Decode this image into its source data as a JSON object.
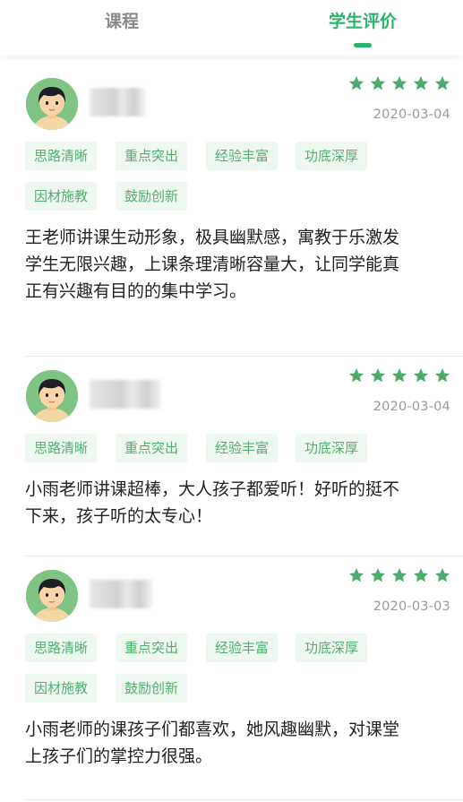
{
  "tabs": {
    "course_label": "课程",
    "review_label": "学生评价"
  },
  "colors": {
    "accent": "#2db36a",
    "tag_text": "#52b06d",
    "tag_bg": "#eef8f0",
    "avatar_bg": "#7fc483"
  },
  "reviews": [
    {
      "rating": 5,
      "date": "2020-03-04",
      "tags": [
        "思路清晰",
        "重点突出",
        "经验丰富",
        "功底深厚",
        "因材施教",
        "鼓励创新"
      ],
      "content": "王老师讲课生动形象，极具幽默感，寓教于乐激发学生无限兴趣，上课条理清晰容量大，让同学能真正有兴趣有目的的集中学习。"
    },
    {
      "rating": 5,
      "date": "2020-03-04",
      "tags": [
        "思路清晰",
        "重点突出",
        "经验丰富",
        "功底深厚"
      ],
      "content": "小雨老师讲课超棒，大人孩子都爱听！好听的挺不下来，孩子听的太专心！"
    },
    {
      "rating": 5,
      "date": "2020-03-03",
      "tags": [
        "思路清晰",
        "重点突出",
        "经验丰富",
        "功底深厚",
        "因材施教",
        "鼓励创新"
      ],
      "content": "小雨老师的课孩子们都喜欢，她风趣幽默，对课堂上孩子们的掌控力很强。"
    }
  ]
}
